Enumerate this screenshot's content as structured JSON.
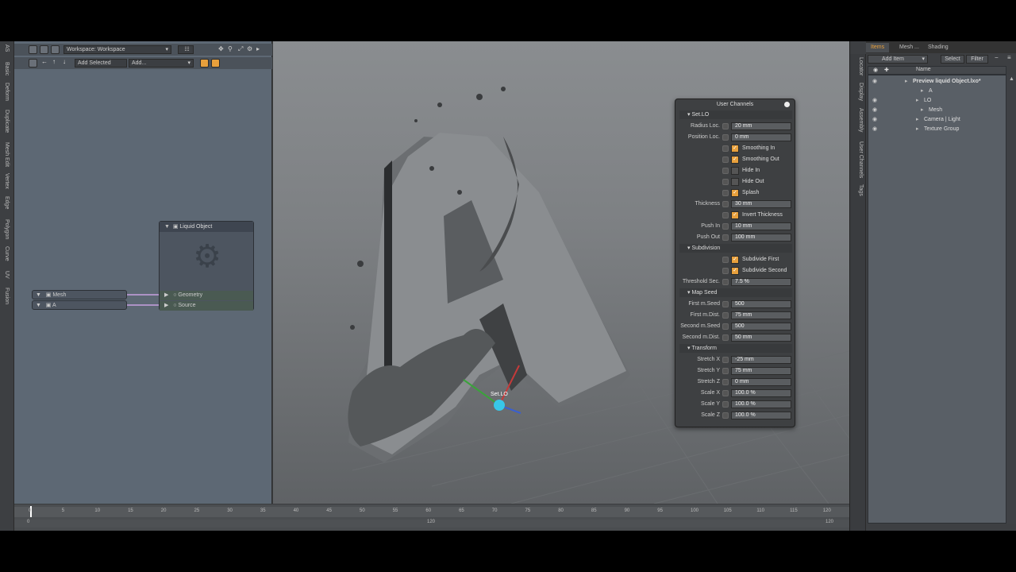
{
  "left_tabs": [
    "AS",
    "Basic",
    "Deform",
    "Duplicate",
    "Mesh Edit",
    "Vertex",
    "Edge",
    "Polygon",
    "Curve",
    "UV",
    "Fusion"
  ],
  "schematic": {
    "workspace": "Workspace: Workspace",
    "add_selected": "Add Selected",
    "add": "Add...",
    "node_title": "Liquid Object",
    "geometry": "Geometry",
    "source": "Source",
    "mesh": "Mesh",
    "a": "A"
  },
  "viewport": {
    "locator_label": "Set.LO"
  },
  "user_channels": {
    "title": "User Channels",
    "sections": [
      {
        "name": "Set.LO",
        "rows": [
          {
            "type": "value",
            "label": "Radius Loc.",
            "value": "20 mm"
          },
          {
            "type": "value",
            "label": "Position Loc.",
            "value": "0 mm"
          },
          {
            "type": "check",
            "label": "Smoothing In",
            "checked": true
          },
          {
            "type": "check",
            "label": "Smoothing Out",
            "checked": true
          },
          {
            "type": "check",
            "label": "Hide In",
            "checked": false
          },
          {
            "type": "check",
            "label": "Hide Out",
            "checked": false
          },
          {
            "type": "check",
            "label": "Splash",
            "checked": true
          },
          {
            "type": "value",
            "label": "Thickness",
            "value": "30 mm"
          },
          {
            "type": "check",
            "label": "Invert Thickness",
            "checked": true
          },
          {
            "type": "value",
            "label": "Push In",
            "value": "10 mm"
          },
          {
            "type": "value",
            "label": "Push Out",
            "value": "100 mm"
          }
        ]
      },
      {
        "name": "Subdivision",
        "rows": [
          {
            "type": "check",
            "label": "Subdivide First",
            "checked": true
          },
          {
            "type": "check",
            "label": "Subdivide Second",
            "checked": true
          },
          {
            "type": "value",
            "label": "Threshold Sec.",
            "value": "7.5 %"
          }
        ]
      },
      {
        "name": "Map Seed",
        "rows": [
          {
            "type": "value",
            "label": "First m.Seed",
            "value": "500"
          },
          {
            "type": "value",
            "label": "First m.Dist.",
            "value": "75 mm"
          },
          {
            "type": "value",
            "label": "Second m.Seed",
            "value": "500"
          },
          {
            "type": "value",
            "label": "Second m.Dist.",
            "value": "50 mm"
          }
        ]
      },
      {
        "name": "Transform",
        "rows": [
          {
            "type": "value",
            "label": "Stretch X",
            "value": "-25 mm"
          },
          {
            "type": "value",
            "label": "Stretch Y",
            "value": "75 mm"
          },
          {
            "type": "value",
            "label": "Stretch Z",
            "value": "0 mm"
          },
          {
            "type": "value",
            "label": "Scale X",
            "value": "100.0 %"
          },
          {
            "type": "value",
            "label": "Scale Y",
            "value": "100.0 %"
          },
          {
            "type": "value",
            "label": "Scale Z",
            "value": "100.0 %"
          }
        ]
      }
    ]
  },
  "timeline": {
    "ticks": [
      "0",
      "5",
      "10",
      "15",
      "20",
      "25",
      "30",
      "35",
      "40",
      "45",
      "50",
      "55",
      "60",
      "65",
      "70",
      "75",
      "80",
      "85",
      "90",
      "95",
      "100",
      "105",
      "110",
      "115",
      "120"
    ],
    "start": "0",
    "mid": "120",
    "end": "120"
  },
  "right_panel": {
    "tabs": [
      "Items",
      "Mesh ...",
      "Shading"
    ],
    "add_item": "Add Item",
    "select": "Select",
    "filter": "Filter",
    "col_name": "Name",
    "vtabs": [
      "Locator",
      "Display",
      "Assembly",
      "User Channels",
      "Tags"
    ],
    "tree": [
      "Preview liquid Object.lxo*",
      "A",
      "LO",
      "Mesh",
      "Camera | Light",
      "Texture Group"
    ]
  }
}
